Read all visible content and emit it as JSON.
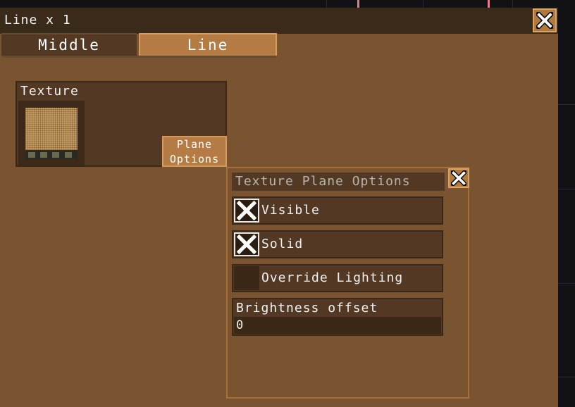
{
  "window": {
    "title": "Line x 1",
    "tabs": [
      {
        "label": "Middle",
        "active": false
      },
      {
        "label": "Line",
        "active": true
      }
    ]
  },
  "texture_panel": {
    "label": "Texture",
    "plane_options_line1": "Plane",
    "plane_options_line2": "Options"
  },
  "popup": {
    "title": "Texture Plane Options",
    "options": [
      {
        "label": "Visible",
        "checked": true
      },
      {
        "label": "Solid",
        "checked": true
      },
      {
        "label": "Override Lighting",
        "checked": false
      }
    ],
    "brightness": {
      "label": "Brightness offset",
      "value": "0"
    }
  },
  "colors": {
    "window_bg": "#7a5330",
    "panel_bg": "#533824",
    "accent": "#b47c44",
    "titlebar": "#3a2a1a"
  },
  "icons": [
    "close-icon",
    "checkmark-x-icon"
  ]
}
